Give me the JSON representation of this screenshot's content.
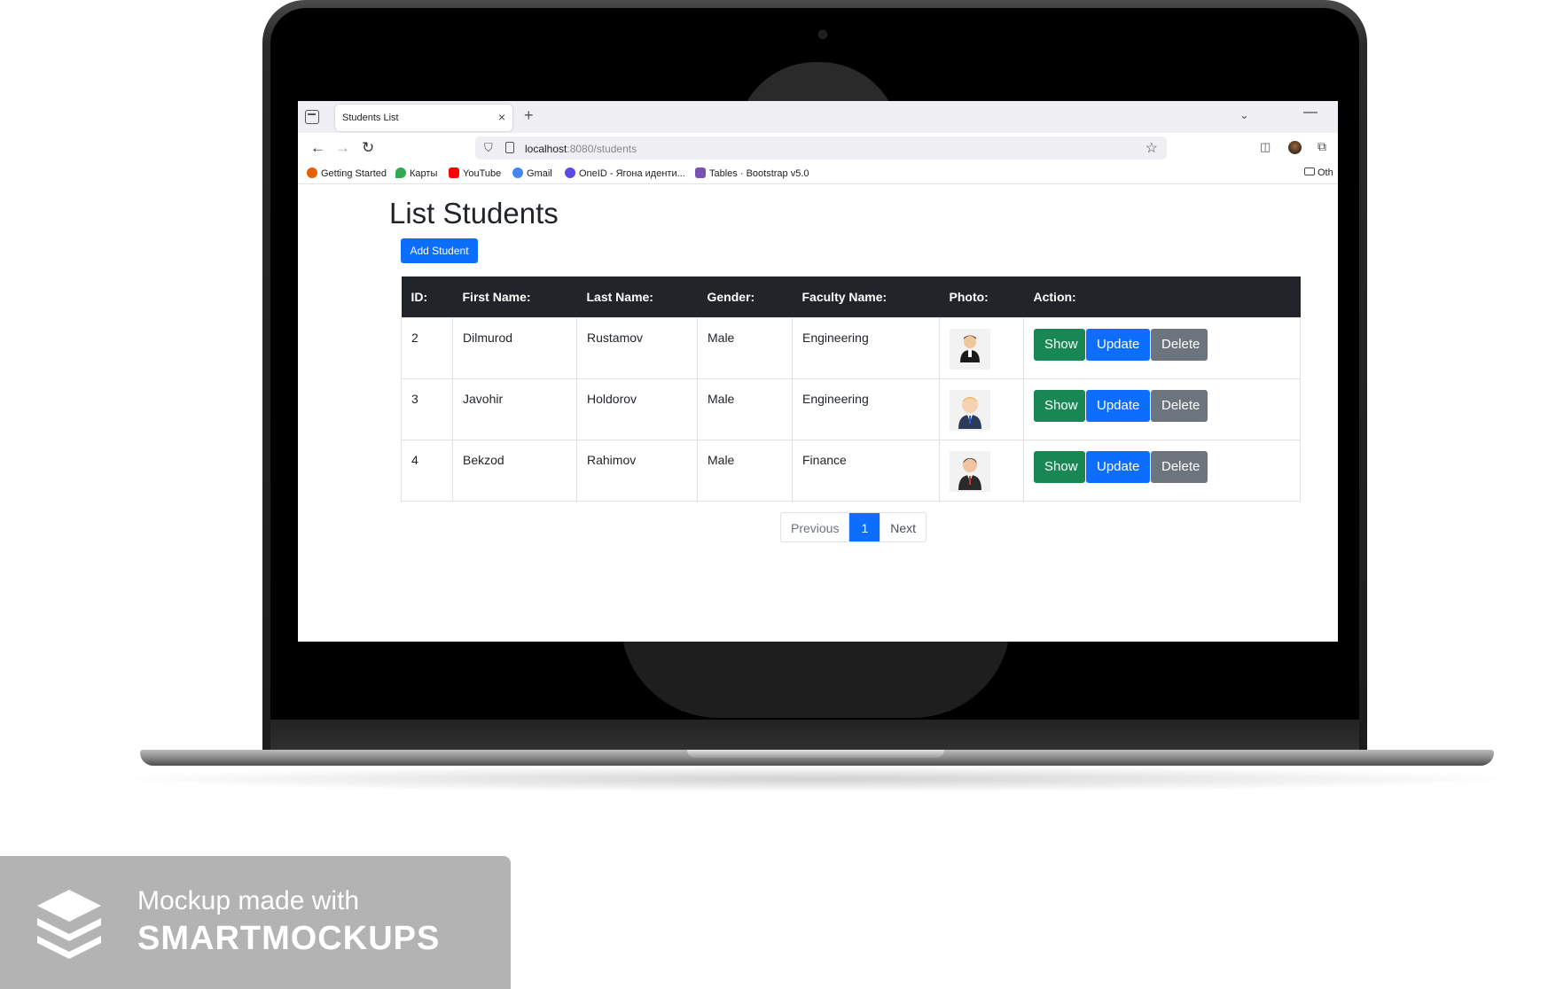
{
  "browser": {
    "tab_title": "Students List",
    "tab_close": "×",
    "new_tab": "+",
    "tabs_menu": "⌄",
    "minimize": "—",
    "url_host": "localhost",
    "url_path": ":8080/students",
    "bookmarks": [
      "Getting Started",
      "Карты",
      "YouTube",
      "Gmail",
      "OneID - Ягона иденти...",
      "Tables · Bootstrap v5.0"
    ],
    "bookmarks_other": "Oth"
  },
  "page": {
    "title": "List Students",
    "add_button": "Add Student",
    "columns": [
      "ID:",
      "First Name:",
      "Last Name:",
      "Gender:",
      "Faculty Name:",
      "Photo:",
      "Action:"
    ],
    "rows": [
      {
        "id": "2",
        "first": "Dilmurod",
        "last": "Rustamov",
        "gender": "Male",
        "faculty": "Engineering"
      },
      {
        "id": "3",
        "first": "Javohir",
        "last": "Holdorov",
        "gender": "Male",
        "faculty": "Engineering"
      },
      {
        "id": "4",
        "first": "Bekzod",
        "last": "Rahimov",
        "gender": "Male",
        "faculty": "Finance"
      }
    ],
    "actions": {
      "show": "Show",
      "update": "Update",
      "delete": "Delete"
    },
    "pagination": {
      "previous": "Previous",
      "current": "1",
      "next": "Next"
    }
  },
  "watermark": {
    "line1": "Mockup made with",
    "line2": "SMARTMOCKUPS"
  },
  "colors": {
    "primary": "#0d6efd",
    "success": "#198754",
    "secondary": "#6c757d",
    "table_header": "#212529"
  }
}
